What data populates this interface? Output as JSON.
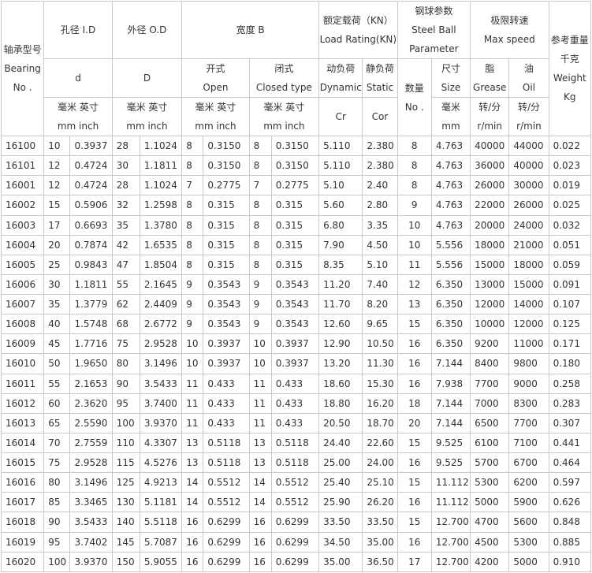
{
  "header": {
    "model": [
      "轴承型号",
      "Bearing",
      "No ."
    ],
    "bore_title": "孔径 I.D",
    "bore_symbol": "d",
    "outer_title": "外径 O.D",
    "outer_symbol": "D",
    "width_title": "宽度 B",
    "open": [
      "开式",
      "Open"
    ],
    "closed": [
      "闭式",
      "Closed type"
    ],
    "load_title": [
      "额定载荷（KN）",
      "Load Rating(KN)"
    ],
    "dynamic": [
      "动负荷",
      "Dynamic"
    ],
    "dynamic_symbol": "Cr",
    "static": [
      "静负荷",
      "Static"
    ],
    "static_symbol": "Cor",
    "ball_title": [
      "钢球参数",
      "Steel Ball",
      "Parameter"
    ],
    "ball_count": [
      "数量",
      "No ."
    ],
    "ball_size": [
      "尺寸",
      "Size"
    ],
    "ball_size_unit": [
      "毫米",
      "mm"
    ],
    "speed_title": [
      "极限转速",
      "Max speed"
    ],
    "grease": [
      "脂",
      "Grease"
    ],
    "oil": [
      "油",
      "Oil"
    ],
    "speed_unit": [
      "转/分",
      "r/min"
    ],
    "weight": [
      "参考重量",
      "千克",
      "Weight",
      "Kg"
    ],
    "mm_inch": [
      "毫米 英寸",
      "mm inch"
    ]
  },
  "rows": [
    [
      "16100",
      "10",
      "0.3937",
      "28",
      "1.1024",
      "8",
      "0.3150",
      "8",
      "0.3150",
      "5.110",
      "2.380",
      "8",
      "4.763",
      "40000",
      "44000",
      "0.022"
    ],
    [
      "16101",
      "12",
      "0.4724",
      "30",
      "1.1811",
      "8",
      "0.3150",
      "8",
      "0.3150",
      "5.110",
      "2.380",
      "8",
      "4.763",
      "36000",
      "40000",
      "0.023"
    ],
    [
      "16001",
      "12",
      "0.4724",
      "28",
      "1.1024",
      "7",
      "0.2775",
      "7",
      "0.2775",
      "5.10",
      "2.40",
      "8",
      "4.763",
      "26000",
      "30000",
      "0.019"
    ],
    [
      "16002",
      "15",
      "0.5906",
      "32",
      "1.2598",
      "8",
      "0.315",
      "8",
      "0.315",
      "5.60",
      "2.80",
      "9",
      "4.763",
      "22000",
      "26000",
      "0.025"
    ],
    [
      "16003",
      "17",
      "0.6693",
      "35",
      "1.3780",
      "8",
      "0.315",
      "8",
      "0.315",
      "6.80",
      "3.35",
      "10",
      "4.763",
      "20000",
      "24000",
      "0.032"
    ],
    [
      "16004",
      "20",
      "0.7874",
      "42",
      "1.6535",
      "8",
      "0.315",
      "8",
      "0.315",
      "7.90",
      "4.50",
      "10",
      "5.556",
      "18000",
      "21000",
      "0.051"
    ],
    [
      "16005",
      "25",
      "0.9843",
      "47",
      "1.8504",
      "8",
      "0.315",
      "8",
      "0.315",
      "8.35",
      "5.10",
      "11",
      "5.556",
      "15000",
      "18000",
      "0.059"
    ],
    [
      "16006",
      "30",
      "1.1811",
      "55",
      "2.1645",
      "9",
      "0.3543",
      "9",
      "0.3543",
      "11.20",
      "7.40",
      "12",
      "6.350",
      "13000",
      "15000",
      "0.091"
    ],
    [
      "16007",
      "35",
      "1.3779",
      "62",
      "2.4409",
      "9",
      "0.3543",
      "9",
      "0.3543",
      "11.70",
      "8.20",
      "13",
      "6.350",
      "12000",
      "14000",
      "0.107"
    ],
    [
      "16008",
      "40",
      "1.5748",
      "68",
      "2.6772",
      "9",
      "0.3543",
      "9",
      "0.3543",
      "12.60",
      "9.65",
      "15",
      "6.350",
      "10000",
      "12000",
      "0.125"
    ],
    [
      "16009",
      "45",
      "1.7716",
      "75",
      "2.9528",
      "10",
      "0.3937",
      "10",
      "0.3937",
      "12.90",
      "10.50",
      "16",
      "6.350",
      "9200",
      "11000",
      "0.171"
    ],
    [
      "16010",
      "50",
      "1.9650",
      "80",
      "3.1496",
      "10",
      "0.3937",
      "10",
      "0.3937",
      "13.20",
      "11.30",
      "16",
      "7.144",
      "8400",
      "9800",
      "0.180"
    ],
    [
      "16011",
      "55",
      "2.1653",
      "90",
      "3.5433",
      "11",
      "0.433",
      "11",
      "0.433",
      "18.60",
      "15.30",
      "16",
      "7.938",
      "7700",
      "9000",
      "0.258"
    ],
    [
      "16012",
      "60",
      "2.3620",
      "95",
      "3.7400",
      "11",
      "0.433",
      "11",
      "0.433",
      "18.80",
      "16.20",
      "18",
      "7.144",
      "7000",
      "8300",
      "0.283"
    ],
    [
      "16013",
      "65",
      "2.5590",
      "100",
      "3.9370",
      "11",
      "0.433",
      "11",
      "0.433",
      "20.50",
      "18.70",
      "20",
      "7.144",
      "6500",
      "7700",
      "0.307"
    ],
    [
      "16014",
      "70",
      "2.7559",
      "110",
      "4.3307",
      "13",
      "0.5118",
      "13",
      "0.5118",
      "24.40",
      "22.60",
      "15",
      "9.525",
      "6100",
      "7100",
      "0.441"
    ],
    [
      "16015",
      "75",
      "2.9528",
      "115",
      "4.5276",
      "13",
      "0.5118",
      "13",
      "0.5118",
      "25.00",
      "24.00",
      "16",
      "9.525",
      "5700",
      "6700",
      "0.464"
    ],
    [
      "16016",
      "80",
      "3.1496",
      "125",
      "4.9213",
      "14",
      "0.5512",
      "14",
      "0.5512",
      "25.40",
      "25.10",
      "15",
      "11.112",
      "5300",
      "6200",
      "0.597"
    ],
    [
      "16017",
      "85",
      "3.3465",
      "130",
      "5.1181",
      "14",
      "0.5512",
      "14",
      "0.5512",
      "25.90",
      "26.20",
      "16",
      "11.112",
      "5000",
      "5900",
      "0.626"
    ],
    [
      "16018",
      "90",
      "3.5433",
      "140",
      "5.5118",
      "16",
      "0.6299",
      "16",
      "0.6299",
      "33.50",
      "33.50",
      "15",
      "12.700",
      "4700",
      "5600",
      "0.848"
    ],
    [
      "16019",
      "95",
      "3.7402",
      "145",
      "5.7087",
      "16",
      "0.6299",
      "16",
      "0.6299",
      "34.50",
      "35.00",
      "16",
      "12.700",
      "4500",
      "5300",
      "0.885"
    ],
    [
      "16020",
      "100",
      "3.9370",
      "150",
      "5.9055",
      "16",
      "0.6299",
      "16",
      "0.6299",
      "35.00",
      "36.50",
      "17",
      "12.700",
      "4200",
      "5000",
      "0.910"
    ]
  ]
}
